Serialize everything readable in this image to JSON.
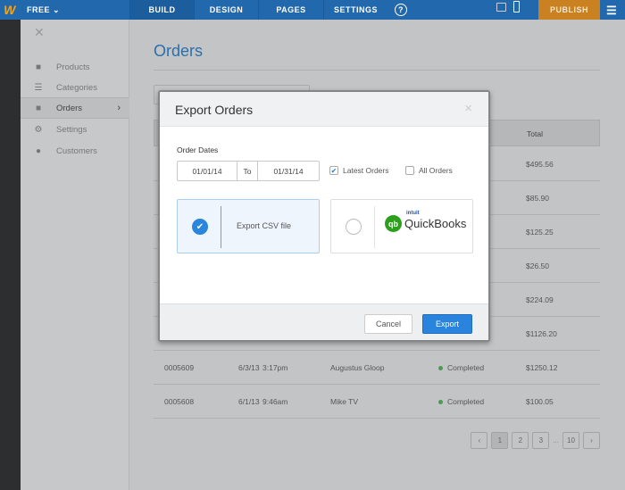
{
  "topbar": {
    "plan": "FREE ⌄",
    "tabs": [
      "BUILD",
      "DESIGN",
      "PAGES",
      "SETTINGS"
    ],
    "active_tab": "BUILD",
    "help": "?",
    "publish": "PUBLISH",
    "accent": "#c98122"
  },
  "sidebar": {
    "items": [
      {
        "label": "Products",
        "icon": "tag-icon"
      },
      {
        "label": "Categories",
        "icon": "list-icon"
      },
      {
        "label": "Orders",
        "icon": "bag-icon"
      },
      {
        "label": "Settings",
        "icon": "gear-icon"
      },
      {
        "label": "Customers",
        "icon": "person-icon"
      }
    ],
    "active": "Orders"
  },
  "main": {
    "title": "Orders",
    "total_header": "Total",
    "rows": [
      {
        "total": "$495.56"
      },
      {
        "total": "$85.90"
      },
      {
        "total": "$125.25"
      },
      {
        "total": "$26.50"
      },
      {
        "total": "$224.09"
      },
      {
        "total": "$1126.20"
      },
      {
        "id": "0005609",
        "date": "6/3/13",
        "time": "3:17pm",
        "customer": "Augustus Gloop",
        "status": "Completed",
        "total": "$1250.12"
      },
      {
        "id": "0005608",
        "date": "6/1/13",
        "time": "9:46am",
        "customer": "Mike TV",
        "status": "Completed",
        "total": "$100.05"
      }
    ],
    "pager": {
      "prev": "‹",
      "pages": [
        "1",
        "2",
        "3"
      ],
      "ellipsis": "...",
      "last": "10",
      "next": "›",
      "current": "1"
    }
  },
  "modal": {
    "title": "Export Orders",
    "close": "×",
    "order_dates_label": "Order Dates",
    "from": "01/01/14",
    "to_label": "To",
    "to": "01/31/14",
    "latest_orders": "Latest Orders",
    "latest_checked": true,
    "all_orders": "All Orders",
    "all_checked": false,
    "csv_option": "Export CSV file",
    "qb_intuit": "intuit",
    "qb_name": "QuickBooks",
    "selected": "csv",
    "cancel": "Cancel",
    "export": "Export"
  }
}
